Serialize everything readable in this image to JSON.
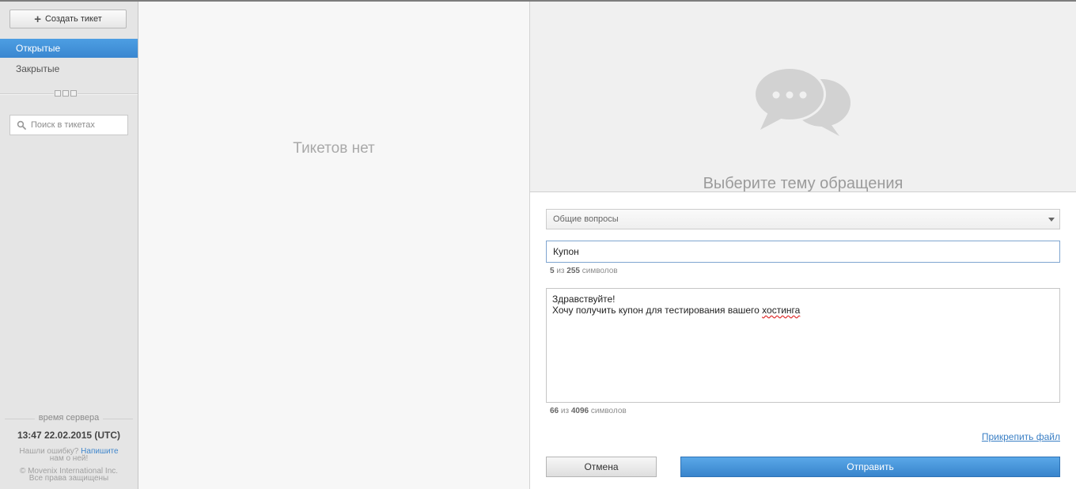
{
  "sidebar": {
    "create_label": "Создать тикет",
    "nav": [
      {
        "label": "Открытые",
        "active": true
      },
      {
        "label": "Закрытые",
        "active": false
      }
    ],
    "search_placeholder": "Поиск в тикетах",
    "server_time_label": "время сервера",
    "server_time": "13:47 22.02.2015 (UTC)",
    "footer": {
      "found_error": "Нашли ошибку?",
      "write_link": "Напишите",
      "tell_us": "нам о ней!",
      "copyright": "© Movenix International Inc.",
      "rights": "Все права защищены"
    }
  },
  "list": {
    "empty_text": "Тикетов нет"
  },
  "new_ticket": {
    "hero_title": "Выберите тему обращения",
    "topic_value": "Общие вопросы",
    "subject_value": "Купон",
    "subject_count": "5",
    "subject_of": "из",
    "subject_max": "255",
    "subject_unit": "символов",
    "message_line1": "Здравствуйте!",
    "message_line2_start": "Хочу получить купон для тестирования вашего ",
    "message_line2_misspelled": "хостинга",
    "message_count": "66",
    "message_of": "из",
    "message_max": "4096",
    "message_unit": "символов",
    "attach_label": "Прикрепить файл",
    "cancel_label": "Отмена",
    "submit_label": "Отправить"
  },
  "colors": {
    "accent": "#3a87d0",
    "sidebar_bg": "#e5e5e5",
    "list_bg": "#f7f7f7"
  }
}
